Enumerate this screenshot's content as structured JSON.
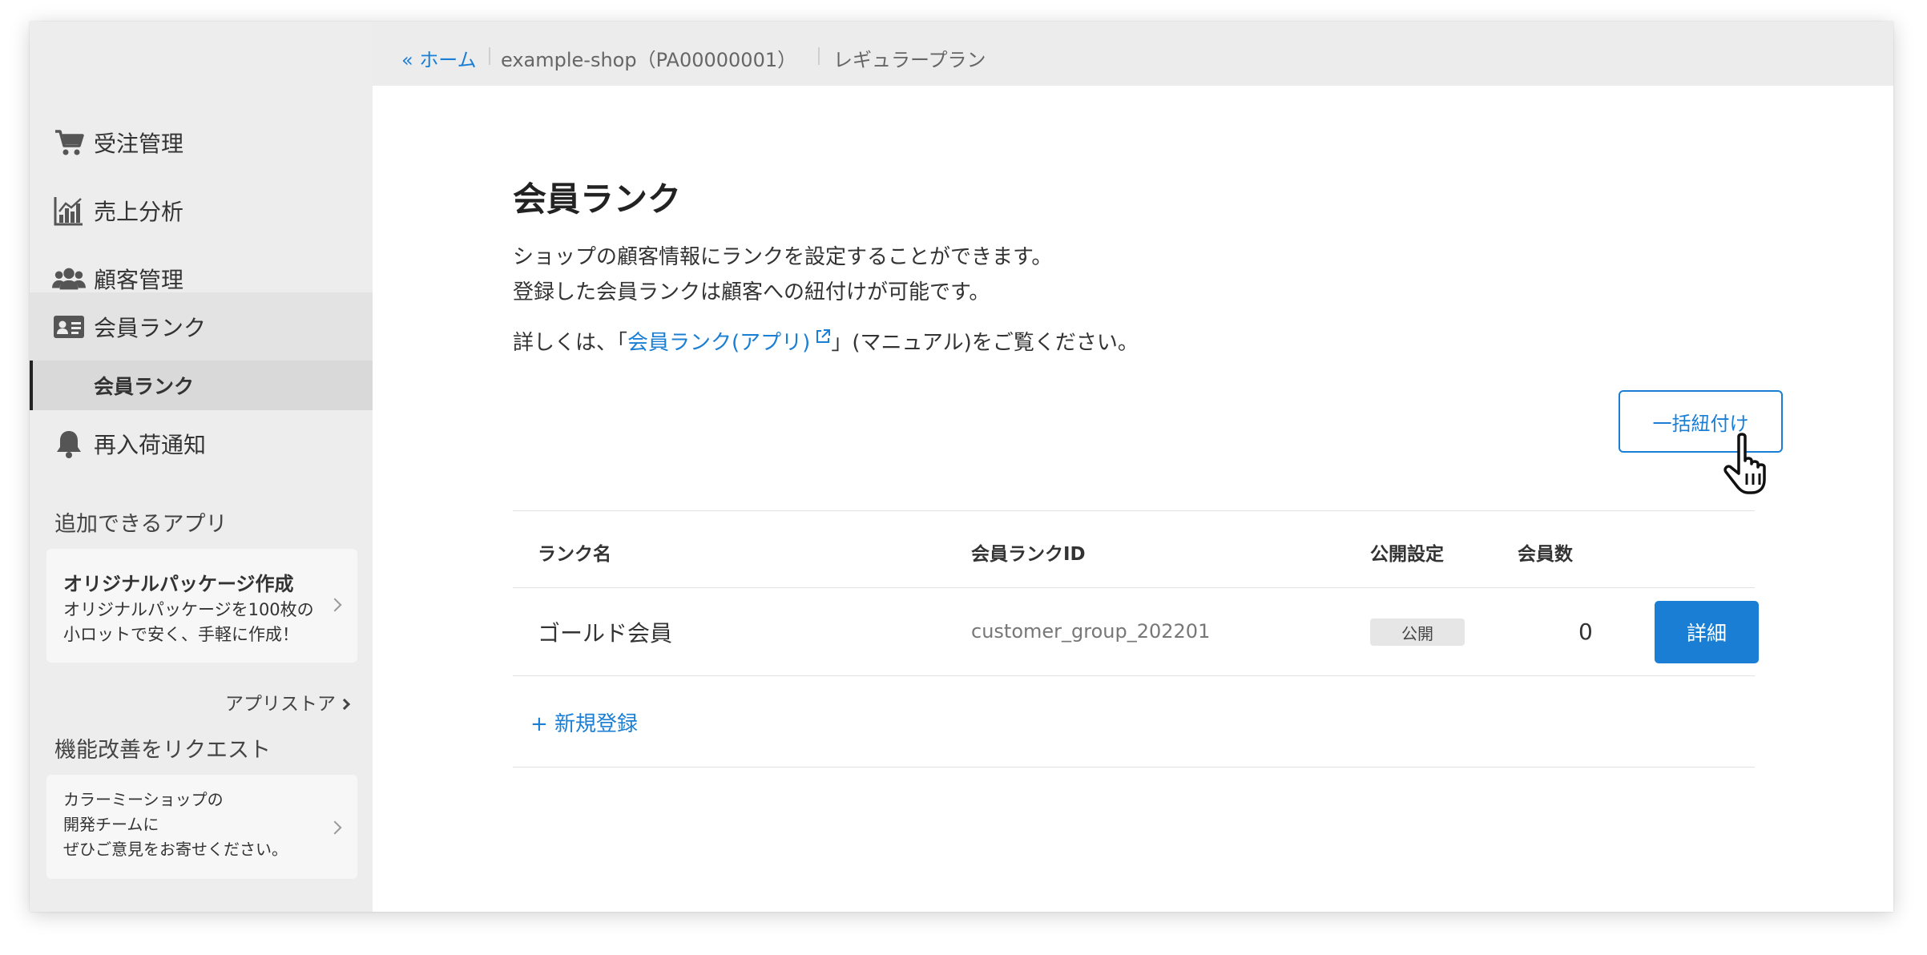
{
  "breadcrumb": {
    "home": "« ホーム",
    "shop": "example-shop（PA00000001）",
    "plan": "レギュラープラン"
  },
  "sidebar": {
    "items": [
      {
        "label": "受注管理",
        "icon": "cart-icon"
      },
      {
        "label": "売上分析",
        "icon": "bar-chart-icon"
      },
      {
        "label": "顧客管理",
        "icon": "users-icon"
      },
      {
        "label": "会員ランク",
        "icon": "id-card-icon"
      },
      {
        "label": "再入荷通知",
        "icon": "bell-icon"
      }
    ],
    "sub_item": "会員ランク",
    "apps_title": "追加できるアプリ",
    "app_card": {
      "title": "オリジナルパッケージ作成",
      "desc1": "オリジナルパッケージを100枚の",
      "desc2": "小ロットで安く、手軽に作成！"
    },
    "appstore_link": "アプリストア",
    "request_title": "機能改善をリクエスト",
    "request_card": {
      "line1": "カラーミーショップの",
      "line2": "開発チームに",
      "line3": "ぜひご意見をお寄せください。"
    }
  },
  "main": {
    "title": "会員ランク",
    "desc1": "ショップの顧客情報にランクを設定することができます。",
    "desc2": "登録した会員ランクは顧客への紐付けが可能です。",
    "desc3_prefix": "詳しくは、「",
    "desc3_link": "会員ランク(アプリ)",
    "desc3_suffix": "」(マニュアル)をご覧ください。",
    "bulk_button": "一括紐付け",
    "table": {
      "headers": [
        "ランク名",
        "会員ランクID",
        "公開設定",
        "会員数"
      ],
      "rows": [
        {
          "name": "ゴールド会員",
          "id": "customer_group_202201",
          "status": "公開",
          "count": "0",
          "action": "詳細"
        }
      ]
    },
    "new_link": "+ 新規登録"
  },
  "colors": {
    "accent": "#1a7fd4",
    "sidebar_bg": "#ededed",
    "topbar_bg": "#ececec"
  }
}
